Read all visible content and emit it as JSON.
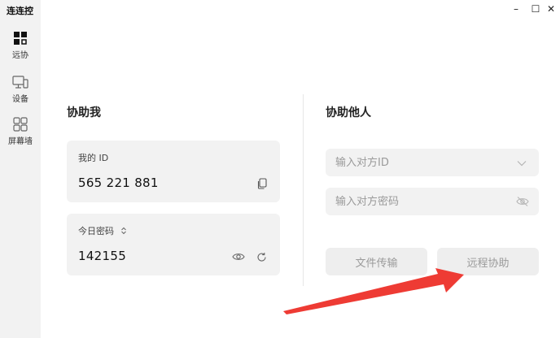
{
  "app": {
    "title": "连连控"
  },
  "window_controls": {
    "minimize": "–",
    "maximize": "☐",
    "close": "✕"
  },
  "sidebar": {
    "items": [
      {
        "label": "远协",
        "icon": "remote-assist-icon",
        "active": true
      },
      {
        "label": "设备",
        "icon": "device-icon",
        "active": false
      },
      {
        "label": "屏幕墙",
        "icon": "screen-wall-icon",
        "active": false
      }
    ]
  },
  "help_me": {
    "title": "协助我",
    "my_id": {
      "label": "我的 ID",
      "value": "565 221 881"
    },
    "today_password": {
      "label": "今日密码",
      "value": "142155"
    }
  },
  "help_others": {
    "title": "协助他人",
    "id_input": {
      "placeholder": "输入对方ID",
      "value": ""
    },
    "password_input": {
      "placeholder": "输入对方密码",
      "value": ""
    },
    "file_transfer_label": "文件传输",
    "remote_assist_label": "远程协助"
  },
  "colors": {
    "sidebar_bg": "#f2f2f2",
    "card_bg": "#f2f2f2",
    "annotation_arrow": "#ee3b34"
  }
}
